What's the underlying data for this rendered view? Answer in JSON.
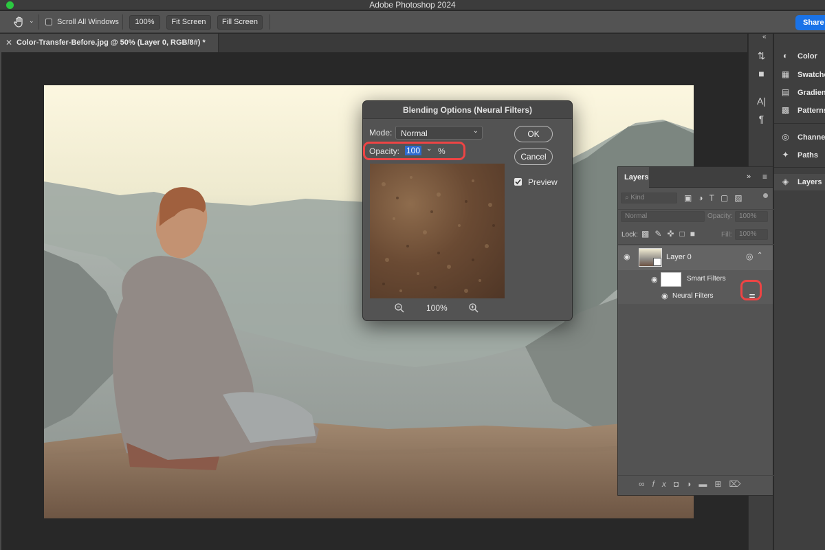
{
  "app": {
    "title": "Adobe Photoshop 2024"
  },
  "options_bar": {
    "scroll_all_windows": "Scroll All Windows",
    "zoom_100": "100%",
    "fit_screen": "Fit Screen",
    "fill_screen": "Fill Screen",
    "share": "Share"
  },
  "document": {
    "tab_label": "Color-Transfer-Before.jpg @ 50% (Layer 0, RGB/8#) *"
  },
  "dialog": {
    "title": "Blending Options (Neural Filters)",
    "mode_label": "Mode:",
    "mode_value": "Normal",
    "opacity_label": "Opacity:",
    "opacity_value": "100",
    "opacity_unit": "%",
    "ok": "OK",
    "cancel": "Cancel",
    "preview_label": "Preview",
    "preview_checked": true,
    "zoom_level": "100%"
  },
  "side_panels": {
    "items": [
      {
        "label": "Color",
        "icon": "palette-icon"
      },
      {
        "label": "Swatches",
        "icon": "swatches-icon"
      },
      {
        "label": "Gradients",
        "icon": "gradient-icon"
      },
      {
        "label": "Patterns",
        "icon": "patterns-icon"
      },
      {
        "label": "Channels",
        "icon": "channels-icon"
      },
      {
        "label": "Paths",
        "icon": "paths-icon"
      },
      {
        "label": "Layers",
        "icon": "layers-icon"
      }
    ]
  },
  "layers_panel": {
    "tab": "Layers",
    "filter_kind": "Kind",
    "blend_mode": "Normal",
    "opacity_label": "Opacity:",
    "opacity_value": "100%",
    "lock_label": "Lock:",
    "fill_label": "Fill:",
    "fill_value": "100%",
    "layer_name": "Layer 0",
    "smart_filters": "Smart Filters",
    "neural_filters": "Neural Filters"
  },
  "colors": {
    "accent": "#1a73e8",
    "highlight_ring": "#ee4444",
    "selection": "#2d6bcf",
    "panel_bg": "#535353"
  }
}
